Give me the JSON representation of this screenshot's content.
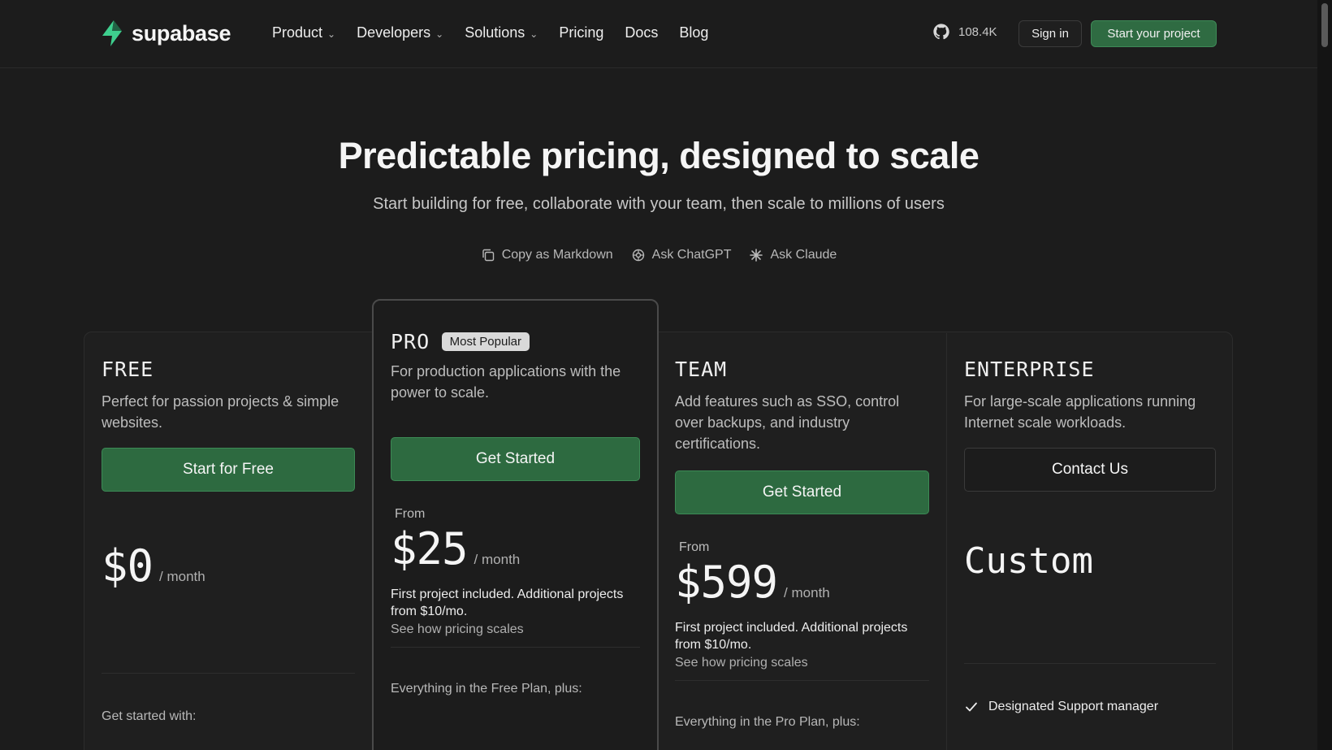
{
  "nav": {
    "brand": "supabase",
    "links": [
      {
        "label": "Product",
        "dropdown": true
      },
      {
        "label": "Developers",
        "dropdown": true
      },
      {
        "label": "Solutions",
        "dropdown": true
      },
      {
        "label": "Pricing",
        "dropdown": false
      },
      {
        "label": "Docs",
        "dropdown": false
      },
      {
        "label": "Blog",
        "dropdown": false
      }
    ],
    "github_stars": "108.4K",
    "sign_in": "Sign in",
    "start_project": "Start your project"
  },
  "hero": {
    "title": "Predictable pricing, designed to scale",
    "subtitle": "Start building for free, collaborate with your team, then scale to millions of users",
    "actions": [
      "Copy as Markdown",
      "Ask ChatGPT",
      "Ask Claude"
    ]
  },
  "plans": {
    "free": {
      "name": "FREE",
      "description": "Perfect for passion projects & simple websites.",
      "cta": "Start for Free",
      "price": "$0",
      "per": "/ month",
      "footer": "Get started with:"
    },
    "pro": {
      "name": "PRO",
      "badge": "Most Popular",
      "description": "For production applications with the power to scale.",
      "cta": "Get Started",
      "from": "From",
      "price": "$25",
      "per": "/ month",
      "note": "First project included. Additional projects from $10/mo.",
      "scales_link": "See how pricing scales",
      "footer": "Everything in the Free Plan, plus:"
    },
    "team": {
      "name": "TEAM",
      "description": "Add features such as SSO, control over backups, and industry certifications.",
      "cta": "Get Started",
      "from": "From",
      "price": "$599",
      "per": "/ month",
      "note": "First project included. Additional projects from $10/mo.",
      "scales_link": "See how pricing scales",
      "footer": "Everything in the Pro Plan, plus:"
    },
    "enterprise": {
      "name": "ENTERPRISE",
      "description": "For large-scale applications running Internet scale workloads.",
      "cta": "Contact Us",
      "price": "Custom",
      "feature": "Designated Support manager"
    }
  },
  "colors": {
    "background": "#1c1c1c",
    "brand_green": "#3ecf8e",
    "button_green": "#2d6a40"
  },
  "icons": [
    "supabase-logo-icon",
    "chevron-down-icon",
    "github-icon",
    "copy-icon",
    "openai-icon",
    "claude-icon",
    "check-icon"
  ]
}
